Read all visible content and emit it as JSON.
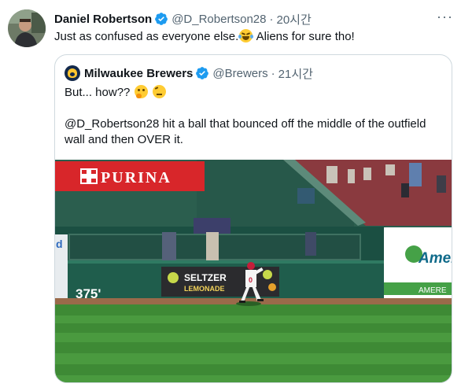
{
  "tweet": {
    "author_name": "Daniel Robertson",
    "author_handle": "@D_Robertson28",
    "separator": "·",
    "time": "20시간",
    "text_before_emoji": "Just as confused as everyone else.",
    "emoji_1": "face-with-tears-of-joy",
    "text_after_emoji": " Aliens for sure tho!",
    "more_label": "···"
  },
  "quoted_tweet": {
    "author_name": "Milwaukee Brewers",
    "author_handle": "@Brewers",
    "separator": "·",
    "time": "21시간",
    "line_1": "But... how?? ",
    "emoji_1": "thinking-face",
    "emoji_2": "face-with-raised-eyebrow",
    "line_2": "@D_Robertson28 hit a ball that bounced off the middle of the outfield",
    "line_3": "wall and then OVER it."
  },
  "media": {
    "sign_purina": "PURINA",
    "distance_marker": "375'",
    "sign_seltzer": "SELTZER",
    "sign_seltzer_sub": "LEMONADE",
    "sign_ameren": "Amer",
    "sign_ameren_sub": "AMERE",
    "wall_letter": "d",
    "player_number": "0"
  },
  "colors": {
    "verified_blue": "#1d9bf0",
    "secondary_text": "#536471",
    "border": "#cfd9de",
    "grass": "#3e8a35",
    "wall": "#1f5d4c",
    "purina_red": "#d8262a"
  }
}
